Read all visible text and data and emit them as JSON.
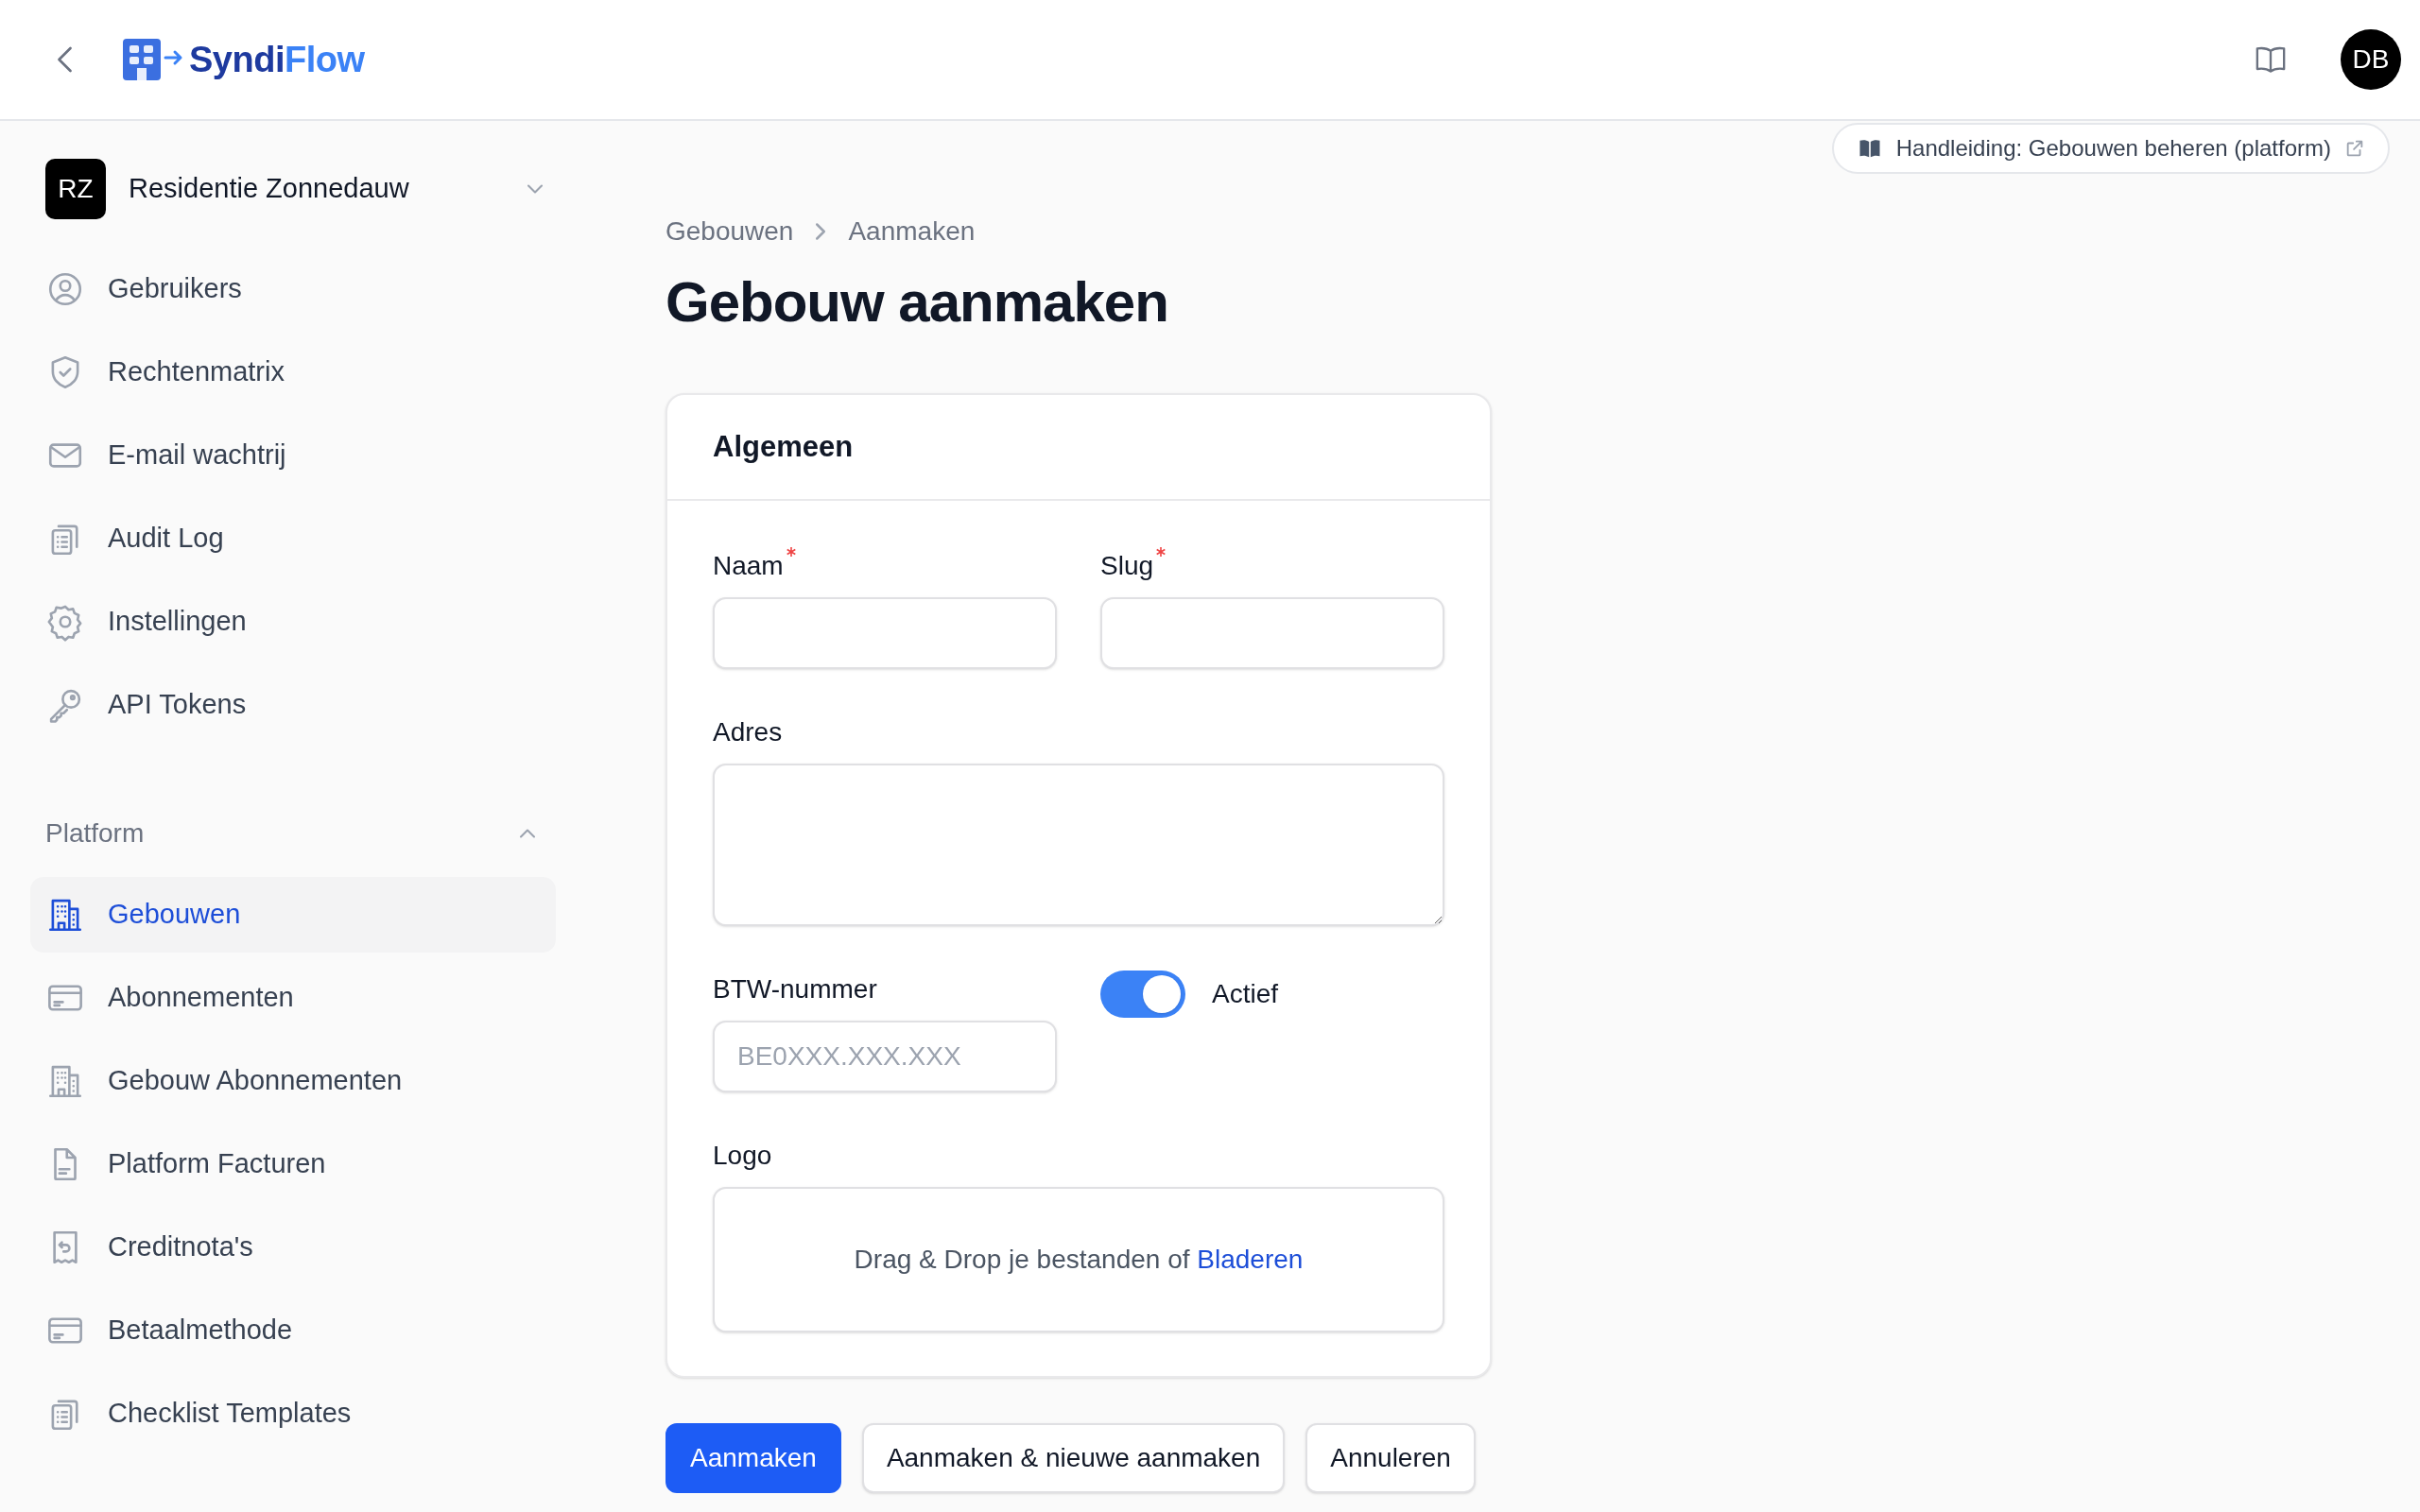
{
  "header": {
    "logo": {
      "text_1": "Syndi",
      "text_2": "Flow"
    },
    "avatar": "DB"
  },
  "guide_link": "Handleiding: Gebouwen beheren (platform)",
  "sidebar": {
    "org": {
      "initials": "RZ",
      "name": "Residentie Zonnedauw"
    },
    "items": [
      {
        "label": "Gebruikers",
        "selected": false
      },
      {
        "label": "Rechtenmatrix",
        "selected": false
      },
      {
        "label": "E-mail wachtrij",
        "selected": false
      },
      {
        "label": "Audit Log",
        "selected": false
      },
      {
        "label": "Instellingen",
        "selected": false
      },
      {
        "label": "API Tokens",
        "selected": false
      }
    ],
    "section": {
      "title": "Platform",
      "expanded": true,
      "items": [
        {
          "label": "Gebouwen",
          "selected": true
        },
        {
          "label": "Abonnementen",
          "selected": false
        },
        {
          "label": "Gebouw Abonnementen",
          "selected": false
        },
        {
          "label": "Platform Facturen",
          "selected": false
        },
        {
          "label": "Creditnota's",
          "selected": false
        },
        {
          "label": "Betaalmethode",
          "selected": false
        },
        {
          "label": "Checklist Templates",
          "selected": false
        }
      ]
    }
  },
  "breadcrumbs": [
    "Gebouwen",
    "Aanmaken"
  ],
  "title": "Gebouw aanmaken",
  "card": {
    "title": "Algemeen",
    "fields": [
      {
        "kind": "text",
        "label": "Naam",
        "required": true
      },
      {
        "kind": "text",
        "label": "Slug",
        "required": true
      },
      {
        "kind": "textarea",
        "label": "Adres",
        "required": false
      },
      {
        "kind": "text",
        "label": "BTW-nummer",
        "required": false,
        "placeholder": "BE0XXX.XXX.XXX"
      },
      {
        "kind": "toggle",
        "label": "Actief",
        "on": true
      },
      {
        "kind": "upload",
        "label": "Logo",
        "required": false,
        "text": "Drag & Drop je bestanden of ",
        "link": "Bladeren"
      }
    ]
  },
  "buttons": [
    {
      "label": "Aanmaken",
      "kind": "primary"
    },
    {
      "label": "Aanmaken & nieuwe aanmaken",
      "kind": "secondary"
    },
    {
      "label": "Annuleren",
      "kind": "secondary"
    }
  ]
}
